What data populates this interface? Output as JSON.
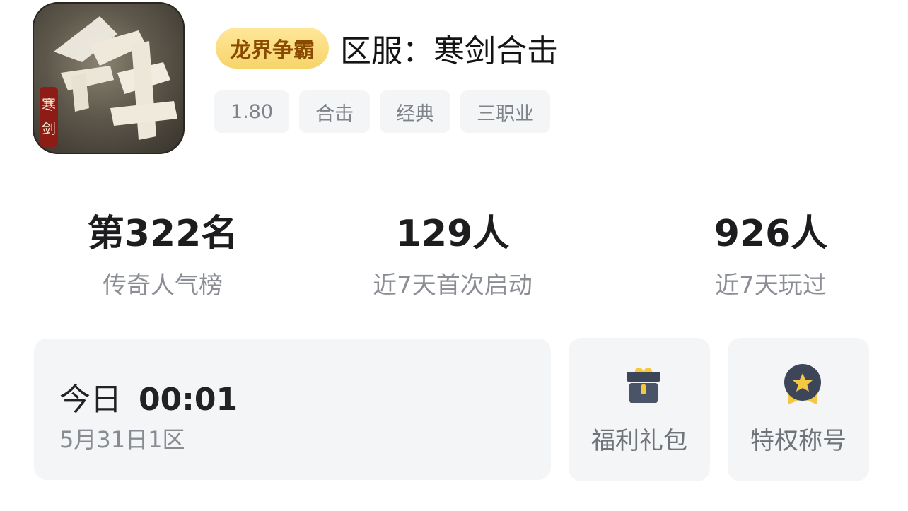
{
  "game": {
    "icon_name": "game-logo-icon",
    "logo_text": "合击 寒剑"
  },
  "server": {
    "badge": "龙界争霸",
    "title": "区服：寒剑合击"
  },
  "tags": [
    "1.80",
    "合击",
    "经典",
    "三职业"
  ],
  "stats": [
    {
      "value": "第322名",
      "label": "传奇人气榜"
    },
    {
      "value": "129人",
      "label": "近7天首次启动"
    },
    {
      "value": "926人",
      "label": "近7天玩过"
    }
  ],
  "open_time": {
    "day": "今日",
    "time": "00:01",
    "detail": "5月31日1区"
  },
  "actions": [
    {
      "label": "福利礼包",
      "icon": "gift-icon"
    },
    {
      "label": "特权称号",
      "icon": "medal-star-icon"
    }
  ],
  "colors": {
    "badge_bg": "#f6d46a",
    "badge_text": "#8a4b00",
    "card_bg": "#f4f5f7",
    "icon_dark": "#3c4658",
    "icon_gold": "#f5c842"
  }
}
